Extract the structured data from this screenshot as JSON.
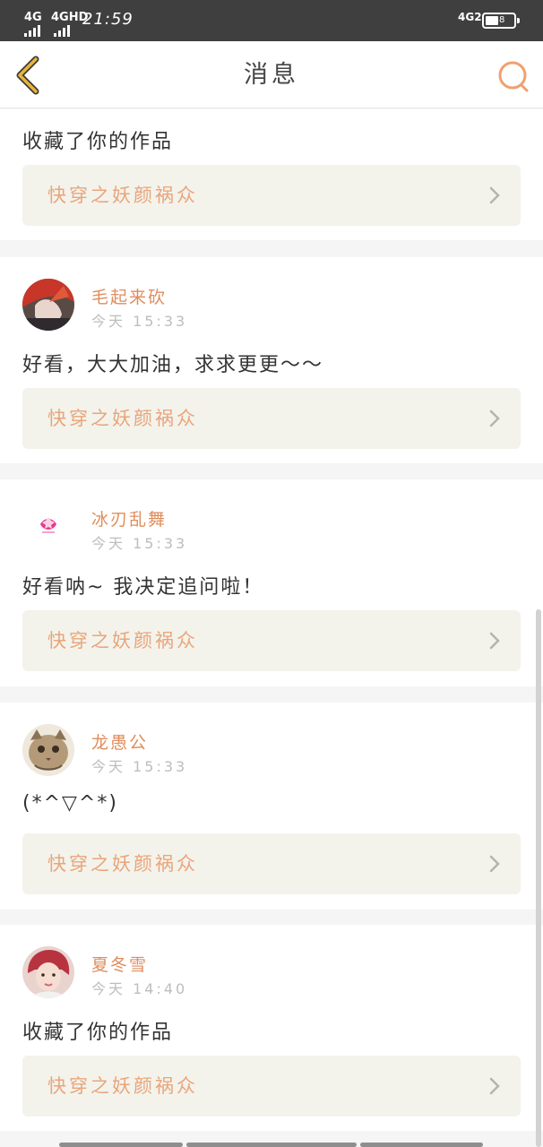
{
  "status": {
    "net_left_1": "4G",
    "net_left_2": "4GHD",
    "time": "21:59",
    "net_right": "4G2",
    "battery": "38"
  },
  "nav": {
    "title": "消息"
  },
  "messages": [
    {
      "comment": "收藏了你的作品",
      "work_title": "快穿之妖颜祸众"
    },
    {
      "user": "毛起来砍",
      "time": "今天 15:33",
      "comment": "好看，大大加油，求求更更～～",
      "work_title": "快穿之妖颜祸众"
    },
    {
      "user": "冰刃乱舞",
      "time": "今天 15:33",
      "comment": "好看呐~ 我决定追问啦！",
      "work_title": "快穿之妖颜祸众"
    },
    {
      "user": "龙愚公",
      "time": "今天 15:33",
      "comment": "(*^▽^*)",
      "work_title": "快穿之妖颜祸众"
    },
    {
      "user": "夏冬雪",
      "time": "今天 14:40",
      "comment": "收藏了你的作品",
      "work_title": "快穿之妖颜祸众"
    }
  ],
  "colors": {
    "accent": "#e08d5d",
    "work_text": "#e9a57b",
    "work_bg": "#f3f3ec",
    "nav_icon": "#e9b43a",
    "search_icon": "#f0a070"
  },
  "icons": {
    "back": "chevron-left-icon",
    "search": "search-icon",
    "chevron": "chevron-right-icon"
  }
}
